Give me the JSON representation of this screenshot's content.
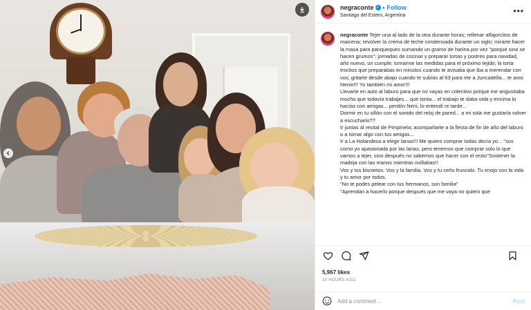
{
  "photo": {
    "download_icon": "download-icon",
    "prev_icon": "chevron-left-icon"
  },
  "header": {
    "username": "negraconte",
    "separator": "•",
    "follow_label": "Follow",
    "location": "Santiago del Estero, Argentina",
    "more_icon": "more-horizontal-icon"
  },
  "caption": {
    "username": "negraconte",
    "paragraphs": [
      "Tejer una al lado de la otra durante horas; rellenar alfajorcitos de maicena; revolver la crema de leche condensada durante un siglo; mirarte hacer la masa para panqueques sumando un gramo de harina por vez \"porque sino se hacen grumos\"; jornadas de cocinar y preparar tortas y postres para navidad, año nuevo, un cumple; tomarme las medidas para el próximo tejido; la torta trocitos que preparabas en minutos cuando te avisaba que iba a merendar con vos; gritarte desde abajo cuando te subías al 63 para irte a Juncadella... te amo Nenin!!! Yo también mi amor!!!",
      "Llevarte en auto al laburo para que no vayas en colectivo porque me angustiaba mucho que todavía trabajes... que tonta... el trabajo te daba vida y encima lo hacías con amigas... perdón Neni, lo entendí re tarde...",
      "Dormir en tu sillón con el sonido del reloj de pared... a mi sola me gustaría volver a escuchario??",
      "Ir juntas al recital de Pimpinela; acompañarte a la fiesta de fin de año del laburo o a tomar algo con tus amigas...",
      "Ir a La Holandesa a elegir lanas!!! Me quiero comprar todas decía yo... \"sos como yo apasionada por las lanas, pero tenemos que comprar solo lo que vamos a tejer, sino después no sabemos que hacer con el resto\"Sostener la madeja con las manos mientras ovillabas!!",
      "Vos y tus bisnietos. Vos y la familia. Vos y tu ceño fruncido. Tu enojo con la vida y tu amor por todos.",
      "\"No te podes pelear con tus hermanos, son familia\"",
      "\"Aprendan a hacerlo porque después que me vaya no quiero que"
    ]
  },
  "actions": {
    "like_icon": "heart-icon",
    "comment_icon": "comment-icon",
    "share_icon": "share-icon",
    "save_icon": "bookmark-icon"
  },
  "likes": "5,967 likes",
  "timestamp": "20 HOURS AGO",
  "comment": {
    "emoji_icon": "emoji-icon",
    "placeholder": "Add a comment...",
    "post_label": "Post"
  },
  "colors": {
    "accent": "#0095f6",
    "post_disabled": "#b2dffc",
    "muted": "#8e8e8e"
  }
}
